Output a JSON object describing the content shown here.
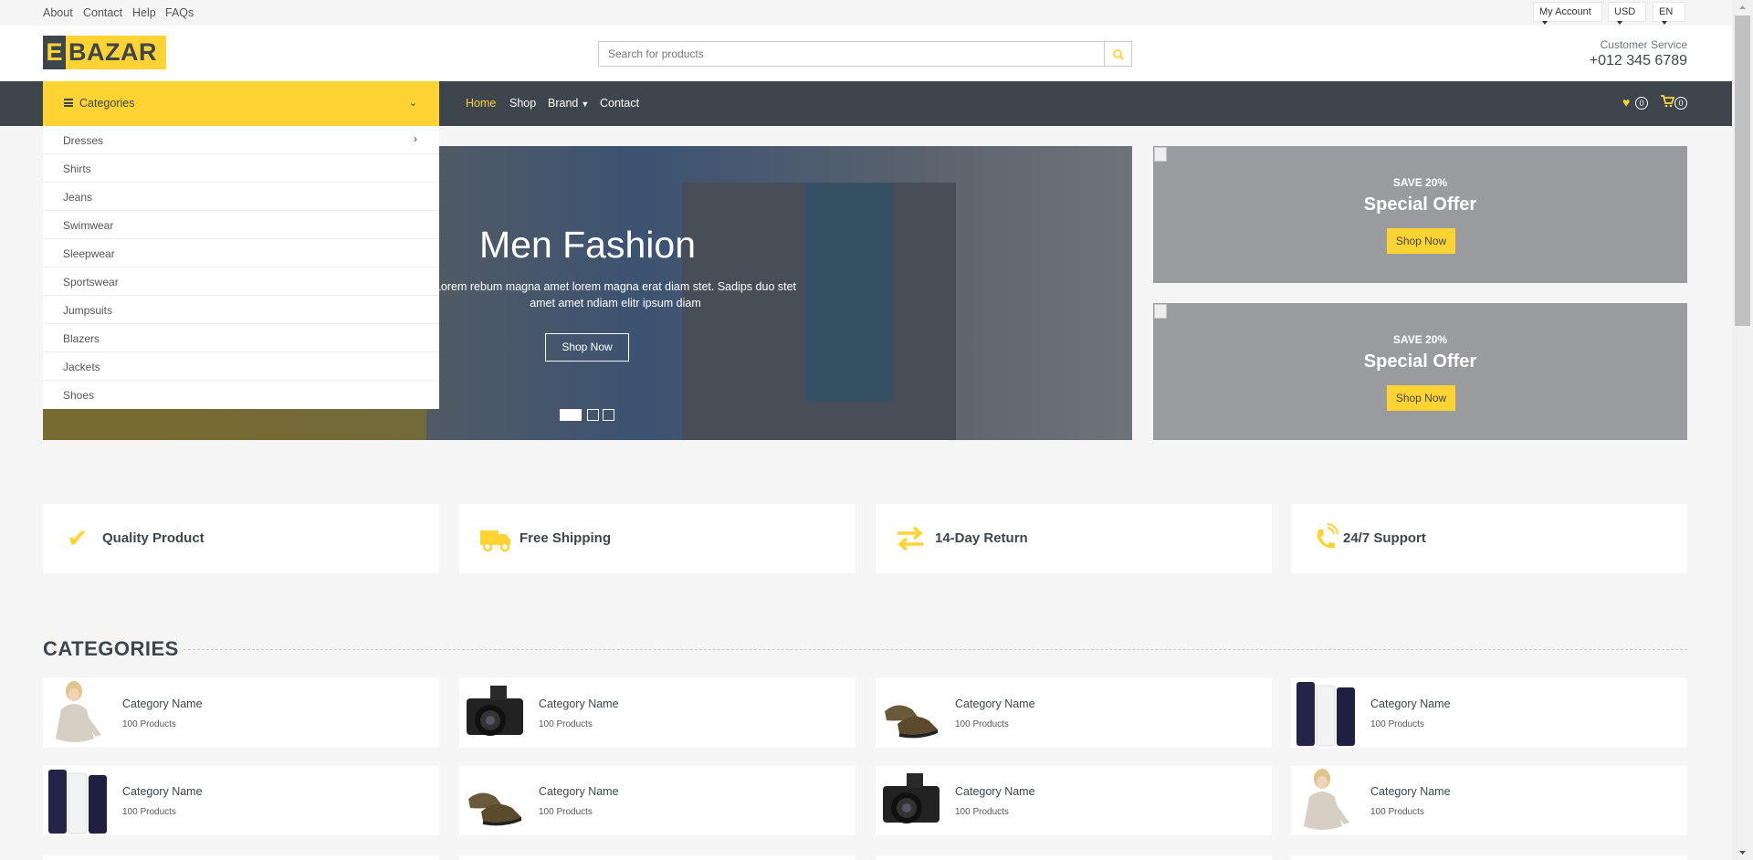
{
  "topbar": {
    "links": [
      "About",
      "Contact",
      "Help",
      "FAQs"
    ],
    "account": "My Account",
    "currency": "USD",
    "language": "EN"
  },
  "header": {
    "logo_e": "E",
    "logo_rest": "BAZAR",
    "search_placeholder": "Search for products",
    "cs_label": "Customer Service",
    "cs_phone": "+012 345 6789"
  },
  "nav": {
    "categories_label": "Categories",
    "links": [
      "Home",
      "Shop",
      "Brand",
      "Contact"
    ],
    "wishlist_count": "0",
    "cart_count": "0"
  },
  "category_menu": [
    "Dresses",
    "Shirts",
    "Jeans",
    "Swimwear",
    "Sleepwear",
    "Sportswear",
    "Jumpsuits",
    "Blazers",
    "Jackets",
    "Shoes"
  ],
  "carousel": {
    "title": "Men Fashion",
    "text": "Lorem rebum magna amet lorem magna erat diam stet. Sadips duo stet amet amet ndiam elitr ipsum diam",
    "button": "Shop Now",
    "slides": 3,
    "active_slide": 1
  },
  "offers": [
    {
      "save": "SAVE 20%",
      "title": "Special Offer",
      "button": "Shop Now"
    },
    {
      "save": "SAVE 20%",
      "title": "Special Offer",
      "button": "Shop Now"
    }
  ],
  "features": [
    "Quality Product",
    "Free Shipping",
    "14-Day Return",
    "24/7 Support"
  ],
  "categories_section": {
    "heading": "CATEGORIES",
    "cards": [
      {
        "name": "Category Name",
        "count": "100 Products",
        "img": "woman"
      },
      {
        "name": "Category Name",
        "count": "100 Products",
        "img": "camera"
      },
      {
        "name": "Category Name",
        "count": "100 Products",
        "img": "shoes"
      },
      {
        "name": "Category Name",
        "count": "100 Products",
        "img": "cosmetics"
      },
      {
        "name": "Category Name",
        "count": "100 Products",
        "img": "cosmetics"
      },
      {
        "name": "Category Name",
        "count": "100 Products",
        "img": "shoes"
      },
      {
        "name": "Category Name",
        "count": "100 Products",
        "img": "camera"
      },
      {
        "name": "Category Name",
        "count": "100 Products",
        "img": "woman"
      }
    ]
  },
  "colors": {
    "accent": "#ffd333",
    "dark": "#3d464d",
    "background": "#f5f5f5"
  }
}
